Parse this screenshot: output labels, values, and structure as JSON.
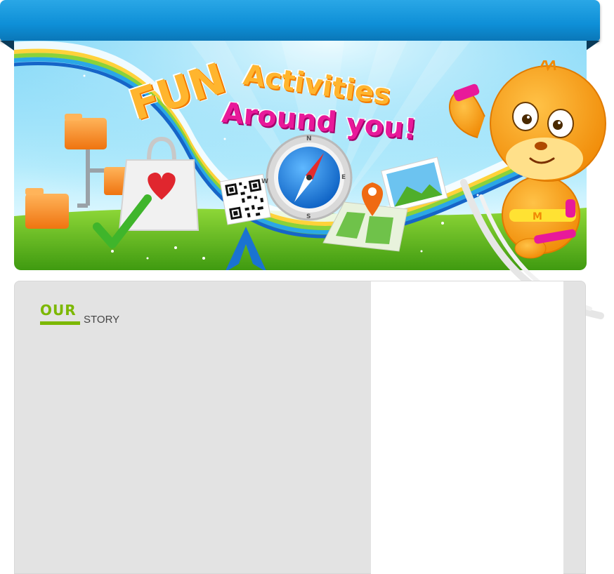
{
  "header": {
    "bar_color": "#0e8fd7"
  },
  "banner": {
    "headline_line1_part1": "FUN",
    "headline_line1_part2": "Activities",
    "headline_line2": "Around you!",
    "compass_letters": {
      "n": "N",
      "s": "S",
      "e": "E",
      "w": "W"
    },
    "icons": [
      "folder-tree-icon",
      "shopping-bag-heart-icon",
      "checkmark-icon",
      "qr-code-icon",
      "compass-icon",
      "photo-icon",
      "map-pin-icon",
      "mascot-character"
    ],
    "colors": {
      "fun": "#ffb52e",
      "around_you": "#e8199a",
      "grass": "#63c21e",
      "sky": "#7fd6f7"
    }
  },
  "story": {
    "title_highlight": "OUR",
    "title_rest": "STORY",
    "accent_color": "#7cb800"
  }
}
